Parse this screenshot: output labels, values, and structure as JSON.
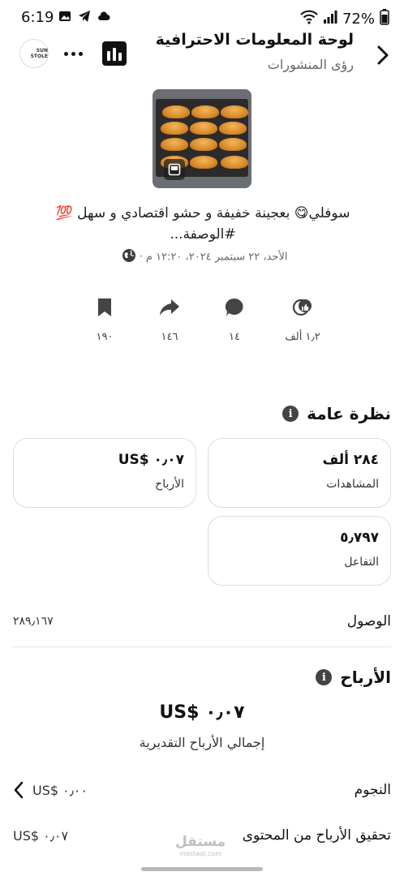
{
  "status_bar": {
    "time": "6:19",
    "battery": "72%"
  },
  "header": {
    "title": "لوحة المعلومات الاحترافية",
    "subtitle": "رؤى المنشورات",
    "avatar_text": "SUN STOLE"
  },
  "post": {
    "caption_line1": "سوفلي😋 بعجينة خفيفة و حشو اقتصادي و سهل 💯",
    "caption_line2": "#الوصفة...",
    "meta": "الأحد، ٢٢ سبتمبر ٢٠٢٤، ١٢:٢٠ م ·"
  },
  "actions": [
    {
      "icon": "reactions-icon",
      "count": "١٫٢ ألف"
    },
    {
      "icon": "comment-icon",
      "count": "١٤"
    },
    {
      "icon": "share-icon",
      "count": "١٤٦"
    },
    {
      "icon": "bookmark-icon",
      "count": "١٩٠"
    }
  ],
  "overview": {
    "title": "نظرة عامة",
    "views": {
      "value": "٢٨٤ ألف",
      "label": "المشاهدات"
    },
    "earnings": {
      "value": "US$ ٠٫٠٧",
      "label": "الأرباح"
    },
    "interactions": {
      "value": "٥٫٧٩٧",
      "label": "التفاعل"
    },
    "reach": {
      "label": "الوصول",
      "value": "٢٨٩٫١٦٧"
    }
  },
  "earnings": {
    "title": "الأرباح",
    "total_value": "US$ ٠٫٠٧",
    "total_label": "إجمالي الأرباح التقديرية",
    "stars": {
      "label": "النجوم",
      "value": "US$ ٠٫٠٠"
    },
    "content_monetization": {
      "label": "تحقيق الأرباح من المحتوى",
      "value": "US$ ٠٫٠٧"
    }
  },
  "watermark": {
    "main": "مستقل",
    "sub": "mostaql.com"
  }
}
